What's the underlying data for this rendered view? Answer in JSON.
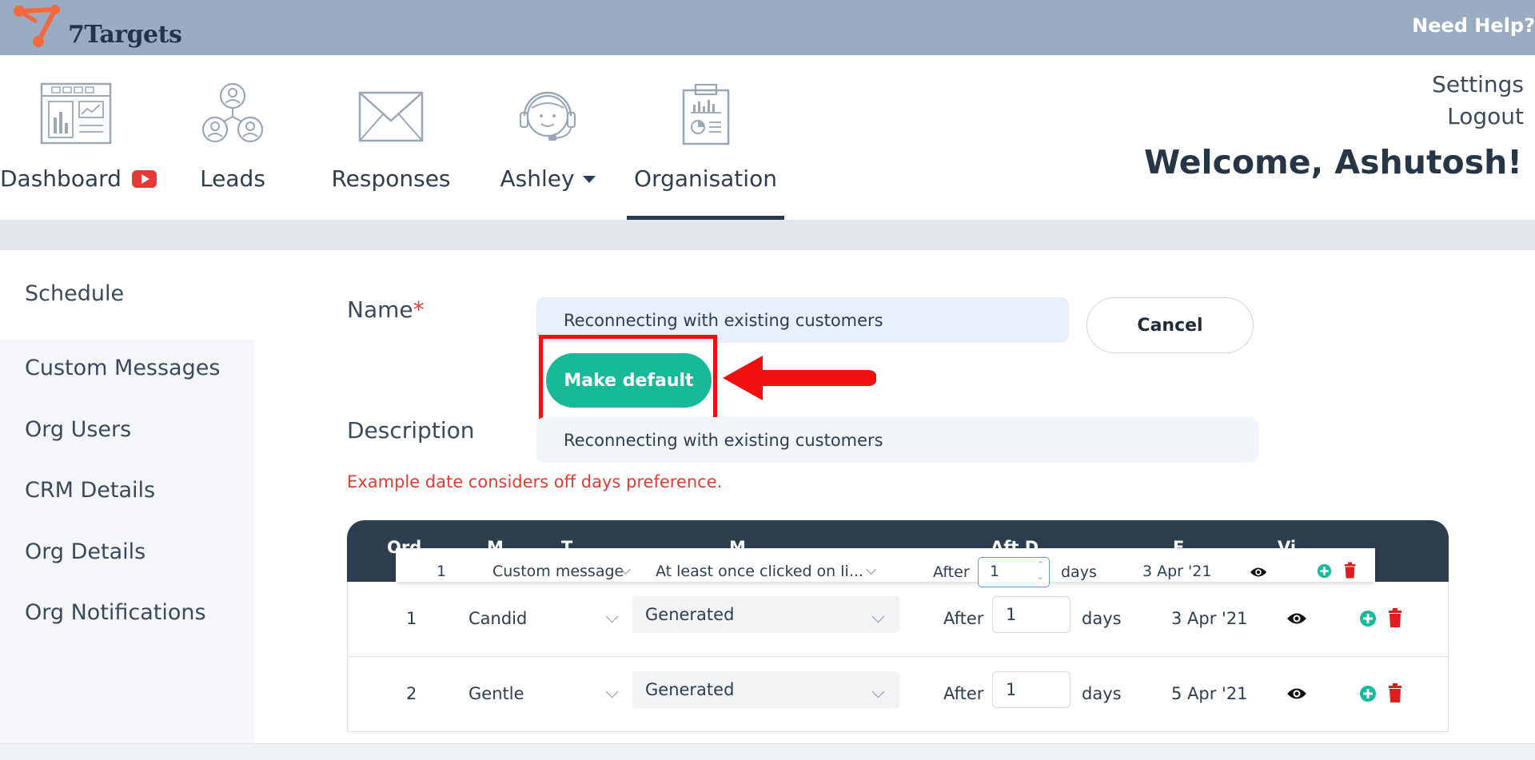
{
  "brand": {
    "name": "7Targets",
    "help": "Need Help?",
    "colors": {
      "topbar": "#9aacc3",
      "accent": "#17b99a",
      "danger": "#e53935",
      "dark": "#2c3e50"
    }
  },
  "nav": {
    "items": [
      {
        "label": "Dashboard",
        "icon": "dashboard-icon",
        "badge_icon": "youtube-icon"
      },
      {
        "label": "Leads",
        "icon": "leads-icon"
      },
      {
        "label": "Responses",
        "icon": "envelope-icon"
      },
      {
        "label": "Ashley",
        "icon": "support-agent-icon",
        "has_dropdown": true
      },
      {
        "label": "Organisation",
        "icon": "clipboard-chart-icon",
        "active": true
      }
    ],
    "settings": "Settings",
    "logout": "Logout",
    "welcome": "Welcome, Ashutosh!"
  },
  "sidebar": {
    "items": [
      "Schedule",
      "Custom Messages",
      "Org Users",
      "CRM Details",
      "Org Details",
      "Org Notifications"
    ],
    "active": "Schedule"
  },
  "form": {
    "name_label": "Name",
    "required_mark": "*",
    "name_value": "Reconnecting with existing customers",
    "cancel_label": "Cancel",
    "make_default_label": "Make default",
    "description_label": "Description",
    "description_value": "Reconnecting with existing customers",
    "warning": "Example date considers off days preference."
  },
  "table": {
    "header_partial": [
      "Ord",
      "M",
      "T",
      "M",
      "Aft D",
      "E",
      "Vi"
    ],
    "dragging_row": {
      "order": "1",
      "type": "Custom message",
      "message": "At least once clicked on li...",
      "after": "After",
      "days_value": "1",
      "days": "days",
      "example": "3 Apr '21"
    },
    "rows": [
      {
        "order": "1",
        "tone": "Candid",
        "message": "Generated",
        "after": "After",
        "days_value": "1",
        "days": "days",
        "example": "3 Apr '21"
      },
      {
        "order": "2",
        "tone": "Gentle",
        "message": "Generated",
        "after": "After",
        "days_value": "1",
        "days": "days",
        "example": "5 Apr '21"
      }
    ]
  }
}
